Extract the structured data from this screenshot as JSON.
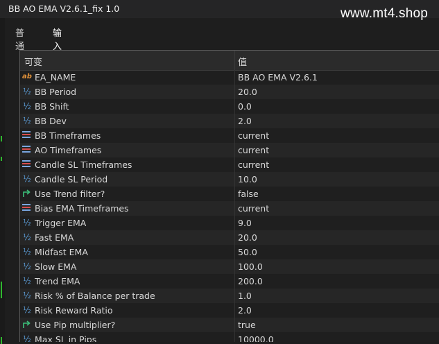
{
  "window": {
    "title": "BB AO EMA V2.6.1_fix 1.0"
  },
  "watermark": "www.mt4.shop",
  "tabs": [
    {
      "label": "普通",
      "active": false
    },
    {
      "label": "输入",
      "active": true
    }
  ],
  "table": {
    "columns": [
      "可变",
      "值"
    ],
    "rows": [
      {
        "icon": "string-icon",
        "name": "EA_NAME",
        "value": "BB AO EMA V2.6.1"
      },
      {
        "icon": "number-icon",
        "name": "BB Period",
        "value": "20.0"
      },
      {
        "icon": "number-icon",
        "name": "BB Shift",
        "value": "0.0"
      },
      {
        "icon": "number-icon",
        "name": "BB Dev",
        "value": "2.0"
      },
      {
        "icon": "enum-icon",
        "name": "BB Timeframes",
        "value": "current"
      },
      {
        "icon": "enum-icon",
        "name": "AO Timeframes",
        "value": "current"
      },
      {
        "icon": "enum-icon",
        "name": "Candle SL Timeframes",
        "value": "current"
      },
      {
        "icon": "number-icon",
        "name": "Candle SL Period",
        "value": "10.0"
      },
      {
        "icon": "bool-icon",
        "name": "Use Trend filter?",
        "value": "false"
      },
      {
        "icon": "enum-icon",
        "name": "Bias EMA Timeframes",
        "value": "current"
      },
      {
        "icon": "number-icon",
        "name": "Trigger EMA",
        "value": "9.0"
      },
      {
        "icon": "number-icon",
        "name": "Fast EMA",
        "value": "20.0"
      },
      {
        "icon": "number-icon",
        "name": "Midfast EMA",
        "value": "50.0"
      },
      {
        "icon": "number-icon",
        "name": "Slow EMA",
        "value": "100.0"
      },
      {
        "icon": "number-icon",
        "name": "Trend EMA",
        "value": "200.0"
      },
      {
        "icon": "number-icon",
        "name": "Risk % of Balance per trade",
        "value": "1.0"
      },
      {
        "icon": "number-icon",
        "name": "Risk Reward Ratio",
        "value": "2.0"
      },
      {
        "icon": "bool-icon",
        "name": "Use Pip multiplier?",
        "value": "true"
      },
      {
        "icon": "number-icon",
        "name": "Max SL in Pips",
        "value": "10000.0"
      }
    ]
  },
  "colors": {
    "accent": "#3c8ee8",
    "string_icon": "#e0913a",
    "number_icon": "#5b9bd5",
    "bool_icon": "#3cc07a"
  }
}
